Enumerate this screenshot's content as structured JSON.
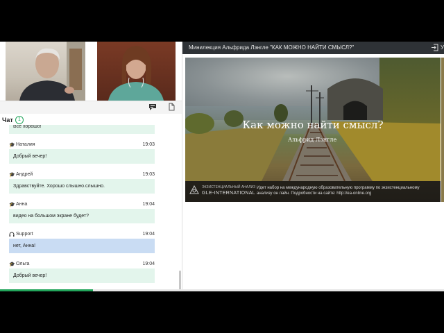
{
  "presentation": {
    "title": "Минилекция Альфрида Лэнгле \"КАК МОЖНО НАЙТИ СМЫСЛ?\"",
    "exit_letter": "У",
    "slide_heading": "Как можно найти смысл?",
    "slide_author": "Альфрид Лэнгле",
    "logo_small": "ЭКЗИСТЕНЦИАЛЬНЫЙ АНАЛИЗ",
    "logo_big": "GLE-INTERNATIONAL",
    "footer_text": "Идет набор на международную образовательную программу по экзистенциальному анализу он лайн. Подробности на сайте: http://ea-online.org"
  },
  "chat": {
    "title": "Чат",
    "badge": "1",
    "partial_message": "Все хорошо!",
    "messages": [
      {
        "author": "Наталия",
        "time": "19:03",
        "text": "Добрый вечер!",
        "role": "student"
      },
      {
        "author": "Андрей",
        "time": "19:03",
        "text": "Здравствуйте. Хорошо слышно.слышно.",
        "role": "student"
      },
      {
        "author": "Анна",
        "time": "19:04",
        "text": "видео на большом экране будет?",
        "role": "student"
      },
      {
        "author": "Support",
        "time": "19:04",
        "text": "нет, Анна!",
        "role": "support"
      },
      {
        "author": "Ольга",
        "time": "19:04",
        "text": "Добрый вечер!",
        "role": "student"
      }
    ]
  },
  "icons": {
    "student": "graduation-cap-icon",
    "support": "headset-icon",
    "chat_tab": "chat-icon",
    "files_tab": "file-icon",
    "exit": "exit-icon"
  },
  "colors": {
    "accent": "#22a55b",
    "bubble_student": "#e3f5ec",
    "bubble_support": "#c9dcf3",
    "title_bar": "#2e3236"
  },
  "playback_progress": 0.21
}
